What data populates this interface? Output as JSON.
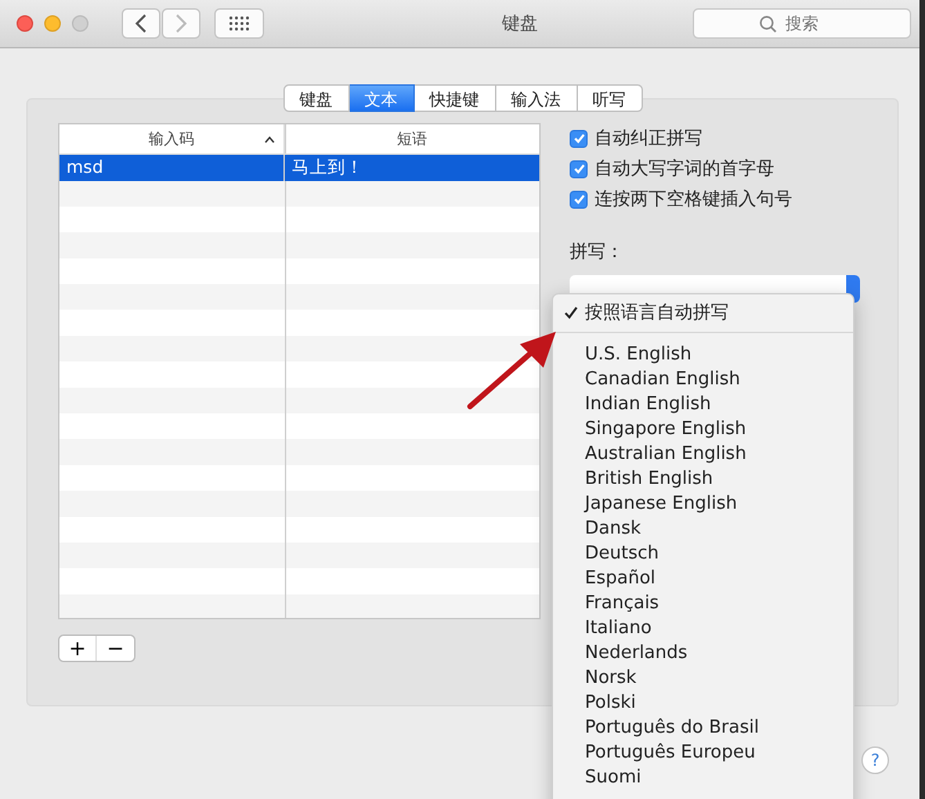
{
  "window": {
    "title": "键盘",
    "close_enabled": true,
    "minimize_enabled": true,
    "zoom_enabled": false,
    "back_enabled": true,
    "forward_enabled": false
  },
  "search": {
    "placeholder": "搜索"
  },
  "tabs": [
    {
      "label": "键盘",
      "selected": false
    },
    {
      "label": "文本",
      "selected": true
    },
    {
      "label": "快捷键",
      "selected": false
    },
    {
      "label": "输入法",
      "selected": false
    },
    {
      "label": "听写",
      "selected": false
    }
  ],
  "table": {
    "columns": [
      {
        "label": "输入码",
        "sorted": true
      },
      {
        "label": "短语",
        "sorted": false
      }
    ],
    "rows": [
      {
        "cells": [
          "msd",
          "马上到！"
        ],
        "selected": true
      }
    ]
  },
  "table_buttons": [
    "+",
    "−"
  ],
  "options": [
    {
      "label": "自动纠正拼写",
      "checked": true
    },
    {
      "label": "自动大写字词的首字母",
      "checked": true
    },
    {
      "label": "连按两下空格键插入句号",
      "checked": true
    }
  ],
  "spelling": {
    "label": "拼写：",
    "menu": [
      {
        "kind": "option",
        "label": "按照语言自动拼写",
        "checked": true
      },
      {
        "kind": "separator"
      },
      {
        "kind": "option",
        "label": "U.S. English",
        "checked": false
      },
      {
        "kind": "option",
        "label": "Canadian English",
        "checked": false
      },
      {
        "kind": "option",
        "label": "Indian English",
        "checked": false
      },
      {
        "kind": "option",
        "label": "Singapore English",
        "checked": false
      },
      {
        "kind": "option",
        "label": "Australian English",
        "checked": false
      },
      {
        "kind": "option",
        "label": "British English",
        "checked": false
      },
      {
        "kind": "option",
        "label": "Japanese English",
        "checked": false
      },
      {
        "kind": "option",
        "label": "Dansk",
        "checked": false
      },
      {
        "kind": "option",
        "label": "Deutsch",
        "checked": false
      },
      {
        "kind": "option",
        "label": "Español",
        "checked": false
      },
      {
        "kind": "option",
        "label": "Français",
        "checked": false
      },
      {
        "kind": "option",
        "label": "Italiano",
        "checked": false
      },
      {
        "kind": "option",
        "label": "Nederlands",
        "checked": false
      },
      {
        "kind": "option",
        "label": "Norsk",
        "checked": false
      },
      {
        "kind": "option",
        "label": "Polski",
        "checked": false
      },
      {
        "kind": "option",
        "label": "Português do Brasil",
        "checked": false
      },
      {
        "kind": "option",
        "label": "Português Europeu",
        "checked": false
      },
      {
        "kind": "option",
        "label": "Suomi",
        "checked": false
      }
    ]
  },
  "help": {
    "label": "?"
  }
}
